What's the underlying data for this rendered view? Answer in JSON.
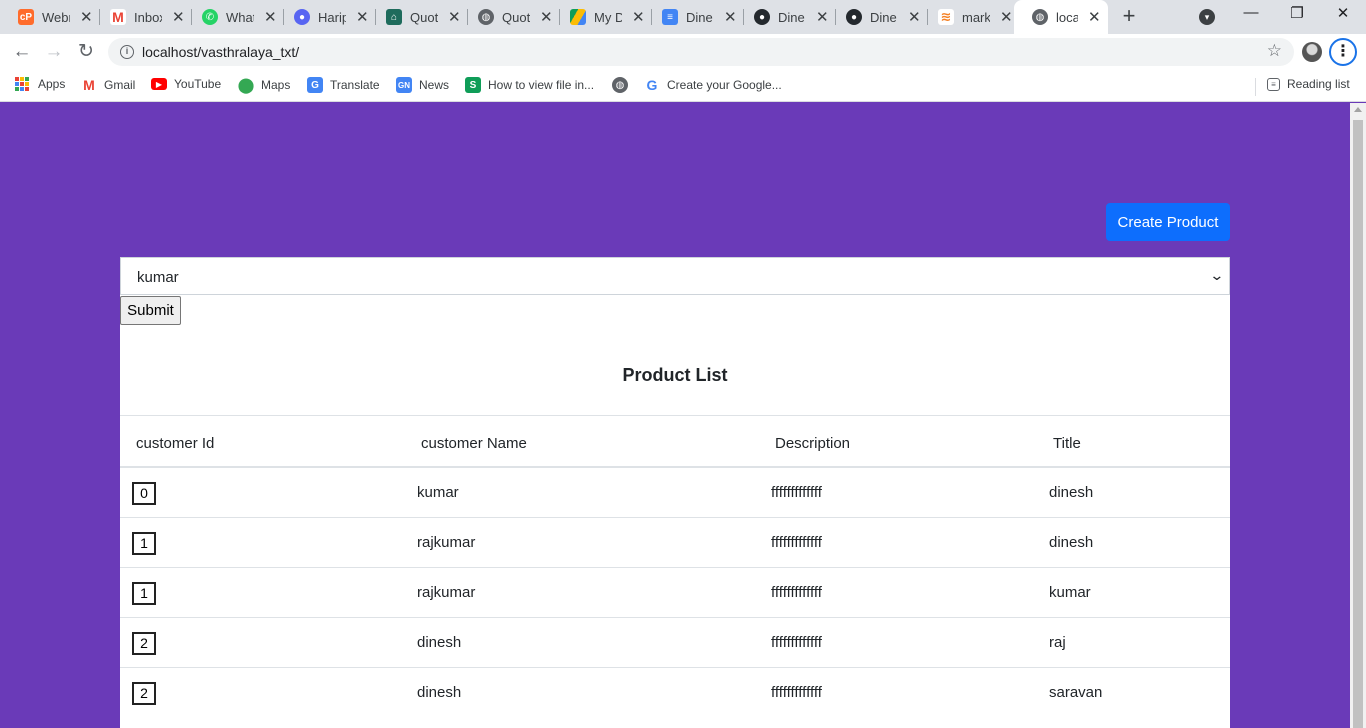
{
  "browser": {
    "tabs": [
      {
        "title": "Webr",
        "favicon": "cpanel-icon",
        "color": "#ff6c2c"
      },
      {
        "title": "Inbox",
        "favicon": "gmail-icon",
        "color": "#ea4335"
      },
      {
        "title": "What",
        "favicon": "whatsapp-icon",
        "color": "#25d366"
      },
      {
        "title": "Harip",
        "favicon": "discord-icon",
        "color": "#5865f2"
      },
      {
        "title": "Quot",
        "favicon": "home-icon",
        "color": "#1e6b5c"
      },
      {
        "title": "Quot",
        "favicon": "globe-icon",
        "color": "#5f6368"
      },
      {
        "title": "My D",
        "favicon": "drive-icon",
        "color": "#fbbc04"
      },
      {
        "title": "Dine",
        "favicon": "docs-icon",
        "color": "#4285f4"
      },
      {
        "title": "Dine",
        "favicon": "github-icon",
        "color": "#24292e"
      },
      {
        "title": "Dine",
        "favicon": "github-icon",
        "color": "#24292e"
      },
      {
        "title": "mark",
        "favicon": "stackoverflow-icon",
        "color": "#f48024"
      },
      {
        "title": "localh",
        "favicon": "globe-icon",
        "color": "#5f6368",
        "active": true
      }
    ],
    "url": "localhost/vasthralaya_txt/",
    "bookmarks": [
      {
        "label": "Apps",
        "icon": "apps-grid-icon"
      },
      {
        "label": "Gmail",
        "icon": "gmail-icon"
      },
      {
        "label": "YouTube",
        "icon": "youtube-icon"
      },
      {
        "label": "Maps",
        "icon": "maps-pin-icon"
      },
      {
        "label": "Translate",
        "icon": "translate-icon"
      },
      {
        "label": "News",
        "icon": "news-icon"
      },
      {
        "label": "How to view file in...",
        "icon": "sheets-icon"
      },
      {
        "label": "",
        "icon": "globe-icon"
      },
      {
        "label": "Create your Google...",
        "icon": "google-icon"
      }
    ],
    "reading_list": "Reading list"
  },
  "page": {
    "create_button": "Create Product",
    "select_value": "kumar",
    "submit_label": "Submit",
    "list_title": "Product List",
    "columns": [
      "customer Id",
      "customer Name",
      "Description",
      "Title"
    ],
    "rows": [
      {
        "id": "0",
        "name": "kumar",
        "description": "fffffffffffff",
        "title": "dinesh"
      },
      {
        "id": "1",
        "name": "rajkumar",
        "description": "fffffffffffff",
        "title": "dinesh"
      },
      {
        "id": "1",
        "name": "rajkumar",
        "description": "fffffffffffff",
        "title": "kumar"
      },
      {
        "id": "2",
        "name": "dinesh",
        "description": "fffffffffffff",
        "title": "raj"
      },
      {
        "id": "2",
        "name": "dinesh",
        "description": "fffffffffffff",
        "title": "saravan"
      }
    ],
    "colors": {
      "background": "#6a3ab8",
      "primary_button": "#0d6efd"
    }
  }
}
